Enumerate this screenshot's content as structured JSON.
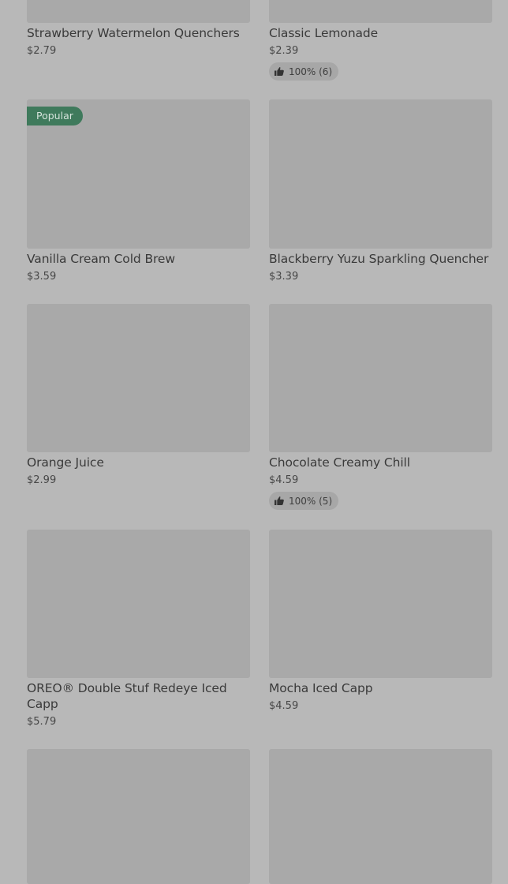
{
  "products": [
    {
      "name": "Strawberry Watermelon Quenchers",
      "price": "$2.79"
    },
    {
      "name": "Classic Lemonade",
      "price": "$2.39",
      "rating": "100% (6)"
    },
    {
      "name": "Vanilla Cream Cold Brew",
      "price": "$3.59",
      "badge": "Popular"
    },
    {
      "name": "Blackberry Yuzu Sparkling Quencher",
      "price": "$3.39"
    },
    {
      "name": "Orange Juice",
      "price": "$2.99"
    },
    {
      "name": "Chocolate Creamy Chill",
      "price": "$4.59",
      "rating": "100% (5)"
    },
    {
      "name": "OREO® Double Stuf Redeye Iced Capp",
      "price": "$5.79"
    },
    {
      "name": "Mocha Iced Capp",
      "price": "$4.59"
    }
  ],
  "icons": {
    "rating": "thumbs-up-icon"
  },
  "colors": {
    "badge": "#3f7a5c",
    "background": "#b8b8b8",
    "image_placeholder": "#a9a9a9"
  }
}
